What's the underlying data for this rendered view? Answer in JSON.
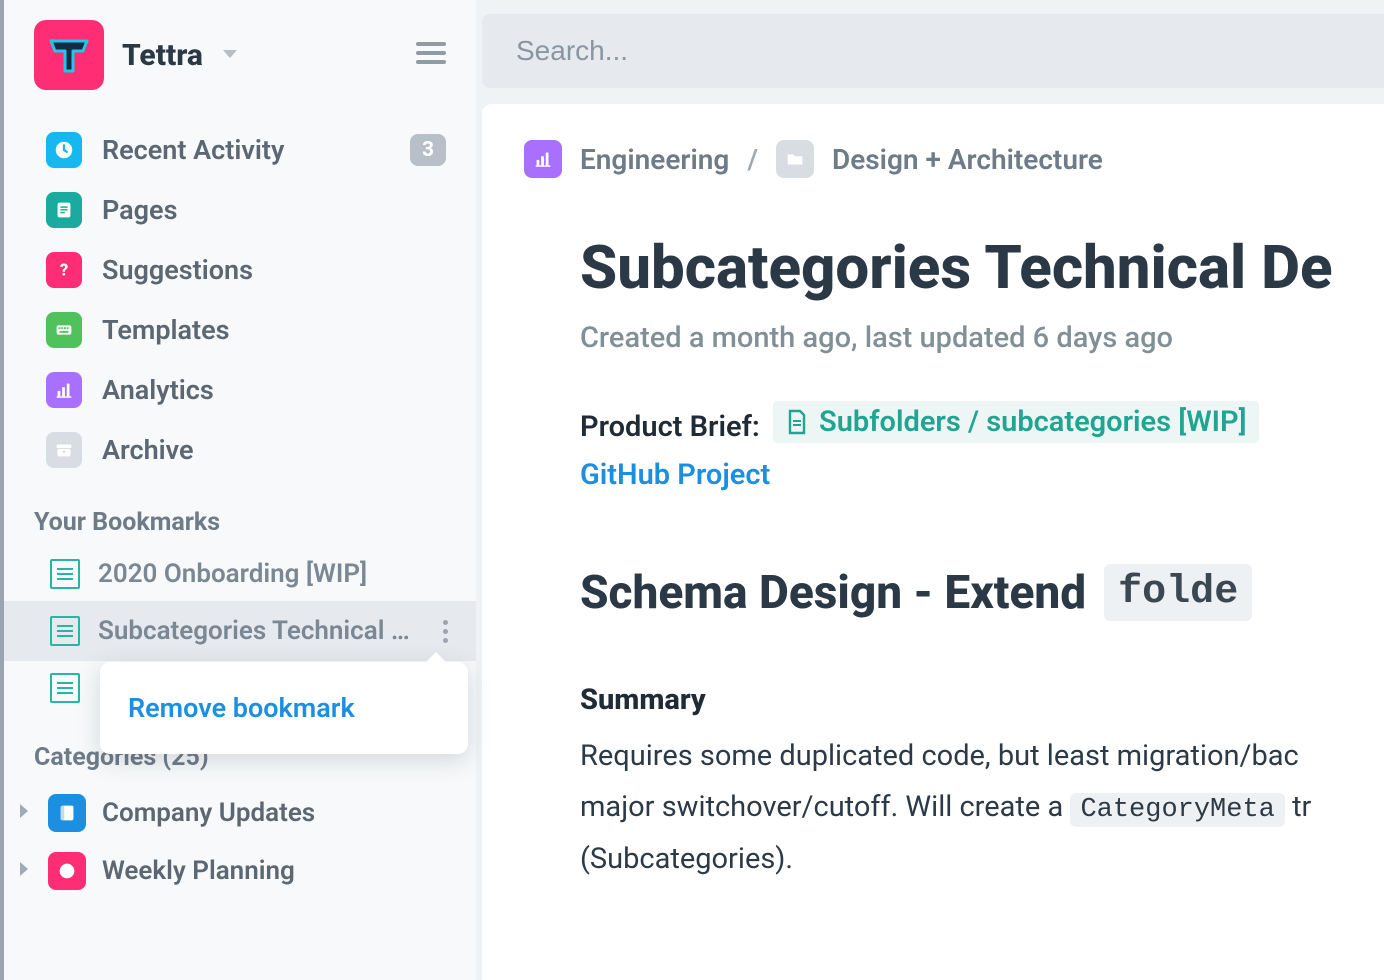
{
  "brand": {
    "name": "Tettra"
  },
  "search": {
    "placeholder": "Search..."
  },
  "nav": {
    "items": [
      {
        "label": "Recent Activity",
        "icon": "clock-icon",
        "color": "#16b8f0",
        "badge": "3"
      },
      {
        "label": "Pages",
        "icon": "page-icon",
        "color": "#1baaa0"
      },
      {
        "label": "Suggestions",
        "icon": "question-icon",
        "color": "#ff2d73"
      },
      {
        "label": "Templates",
        "icon": "keyboard-icon",
        "color": "#4fc25c"
      },
      {
        "label": "Analytics",
        "icon": "chart-icon",
        "color": "#a970ff"
      },
      {
        "label": "Archive",
        "icon": "archive-icon",
        "color": "#d7dde2"
      }
    ]
  },
  "bookmarks": {
    "title": "Your Bookmarks",
    "items": [
      {
        "label": "2020 Onboarding [WIP]"
      },
      {
        "label": "Subcategories Technical D…"
      },
      {
        "label": ""
      }
    ]
  },
  "popover": {
    "remove": "Remove bookmark"
  },
  "categories": {
    "title": "Categories (25)",
    "items": [
      {
        "label": "Company Updates",
        "color": "#1d8fe0",
        "icon": "book-icon"
      },
      {
        "label": "Weekly Planning",
        "color": "#ff2d73",
        "icon": "clock-icon"
      }
    ]
  },
  "breadcrumb": {
    "root": {
      "label": "Engineering",
      "color": "#a970ff"
    },
    "folder": {
      "label": "Design + Architecture"
    }
  },
  "document": {
    "title": "Subcategories Technical De",
    "meta": "Created a month ago, last updated 6 days ago",
    "brief_label": "Product Brief:",
    "brief_link": "Subfolders / subcategories [WIP]",
    "github_link": "GitHub Project",
    "h2_prefix": "Schema Design - Extend",
    "h2_code": "folde",
    "h3": "Summary",
    "body_line1_a": "Requires some duplicated code, but least migration/bac",
    "body_line2_a": "major switchover/cutoff. Will create a ",
    "body_line2_code": "CategoryMeta",
    "body_line2_b": " tr",
    "body_line3": "(Subcategories)."
  }
}
